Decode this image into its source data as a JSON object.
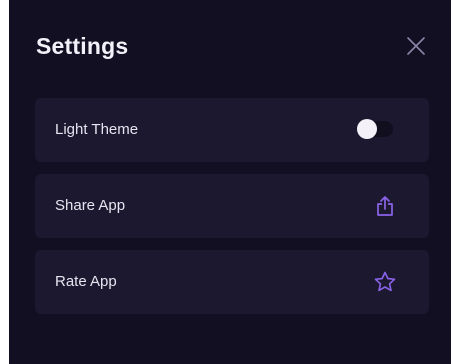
{
  "header": {
    "title": "Settings"
  },
  "settings": {
    "items": [
      {
        "label": "Light Theme",
        "control": "toggle",
        "toggled": false
      },
      {
        "label": "Share App",
        "control": "share-icon"
      },
      {
        "label": "Rate App",
        "control": "star-icon"
      }
    ]
  },
  "colors": {
    "background": "#120f22",
    "row_background": "#1c1830",
    "accent": "#8a63e8",
    "text": "#ece9f4"
  }
}
